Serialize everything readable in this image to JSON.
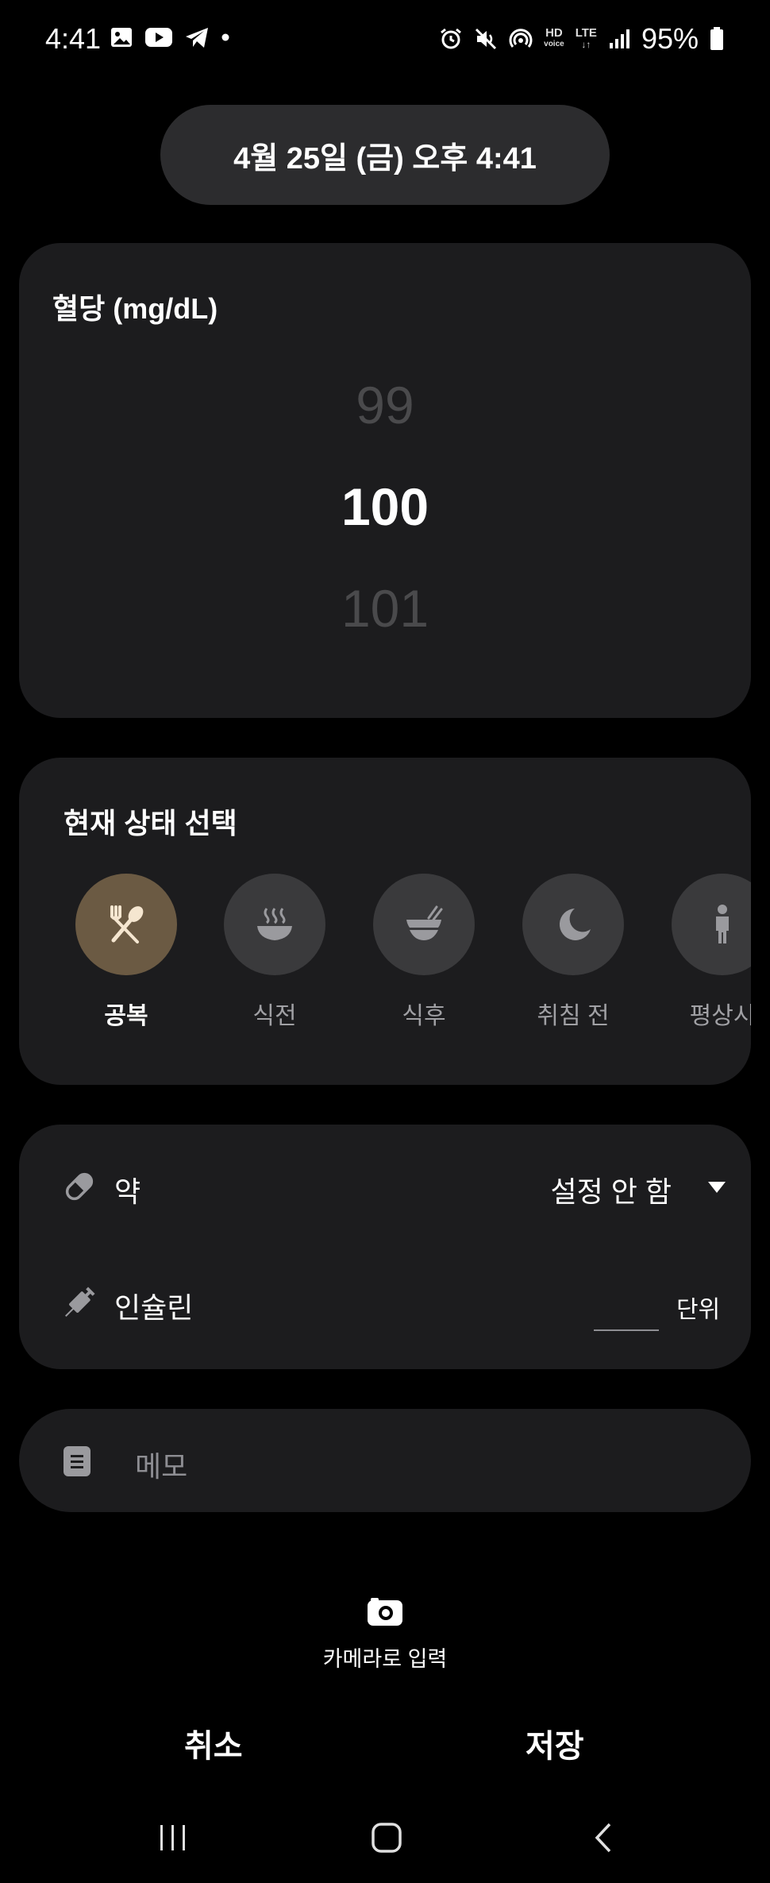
{
  "status_bar": {
    "time": "4:41",
    "battery": "95%",
    "hd_voice_top": "HD",
    "hd_voice_bottom": "voice",
    "lte": "LTE"
  },
  "header": {
    "datetime": "4월 25일 (금) 오후 4:41"
  },
  "blood_glucose": {
    "title": "혈당 (mg/dL)",
    "prev_value": "99",
    "current_value": "100",
    "next_value": "101"
  },
  "state_select": {
    "title": "현재 상태 선택",
    "items": [
      {
        "label": "공복",
        "icon": "fork-spoon-icon",
        "active": true
      },
      {
        "label": "식전",
        "icon": "hot-bowl-icon",
        "active": false
      },
      {
        "label": "식후",
        "icon": "bowl-chopsticks-icon",
        "active": false
      },
      {
        "label": "취침 전",
        "icon": "moon-icon",
        "active": false
      },
      {
        "label": "평상시",
        "icon": "person-icon",
        "active": false
      }
    ]
  },
  "medication": {
    "label": "약",
    "value": "설정 안 함",
    "insulin_label": "인슐린",
    "insulin_unit": "단위",
    "insulin_value": ""
  },
  "memo": {
    "placeholder": "메모"
  },
  "camera": {
    "label": "카메라로 입력"
  },
  "actions": {
    "cancel": "취소",
    "save": "저장"
  },
  "colors": {
    "background": "#000000",
    "card": "#1c1c1e",
    "active_state": "#6b5a43",
    "inactive_state": "#3a3a3c"
  }
}
